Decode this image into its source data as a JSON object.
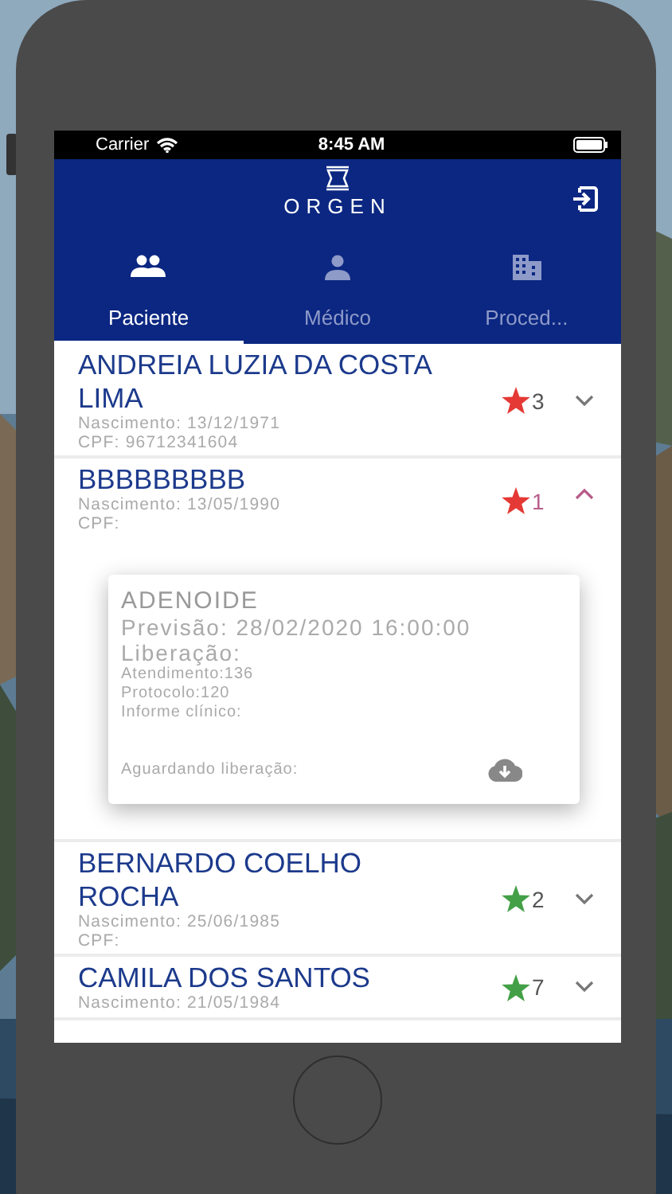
{
  "status_bar": {
    "carrier": "Carrier",
    "time": "8:45 AM"
  },
  "header": {
    "logo": "ORGEN"
  },
  "tabs": [
    {
      "label": "Paciente",
      "kind": "people",
      "selected": true
    },
    {
      "label": "Médico",
      "kind": "person",
      "selected": false
    },
    {
      "label": "Proced...",
      "kind": "building",
      "selected": false
    }
  ],
  "patients": [
    {
      "name": "ANDREIA LUZIA DA COSTA LIMA",
      "birth": "Nascimento: 13/12/1971",
      "cpf": "CPF: 96712341604",
      "count": "3",
      "color": "#e53935",
      "expanded": false
    },
    {
      "name": "BBBBBBBBB",
      "birth": "Nascimento: 13/05/1990",
      "cpf": "CPF:",
      "count": "1",
      "color": "#e53935",
      "expanded": true,
      "detail": {
        "title": "ADENOIDE",
        "forecast": "Previsão: 28/02/2020 16:00:00",
        "release": "Liberação:",
        "lines": [
          "Atendimento:136",
          "Protocolo:120",
          "Informe clínico:"
        ],
        "status": "Aguardando liberação:"
      }
    },
    {
      "name": "BERNARDO COELHO ROCHA",
      "birth": "Nascimento: 25/06/1985",
      "cpf": "CPF:",
      "count": "2",
      "color": "#43a047",
      "expanded": false
    },
    {
      "name": "CAMILA DOS SANTOS",
      "birth": "Nascimento: 21/05/1984",
      "count": "7",
      "color": "#43a047",
      "expanded": false
    }
  ]
}
